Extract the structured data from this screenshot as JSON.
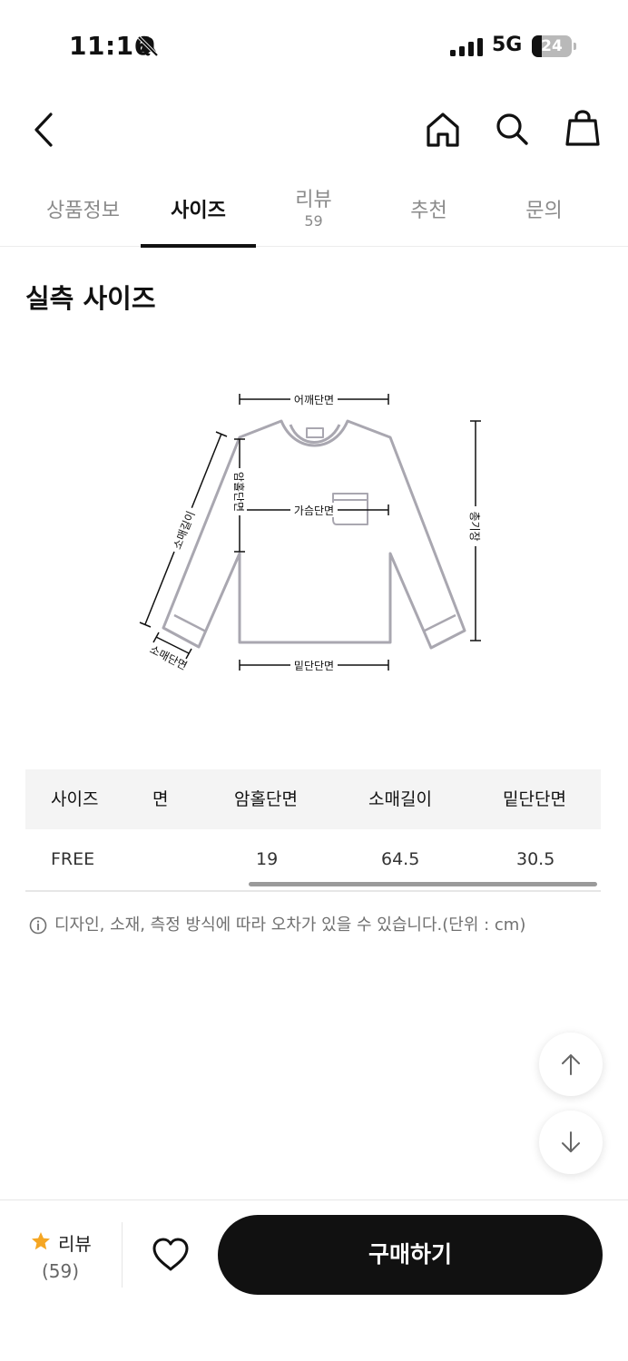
{
  "status_bar": {
    "time": "11:16",
    "network": "5G",
    "battery_level": 24,
    "battery_text": "24",
    "icons": [
      "bell-slash-icon",
      "signal-icon",
      "battery-icon"
    ]
  },
  "header": {
    "icons": [
      "back-arrow-icon",
      "home-icon",
      "search-icon",
      "shopping-bag-icon"
    ]
  },
  "tabs": [
    {
      "label": "상품정보",
      "active": false
    },
    {
      "label": "사이즈",
      "active": true
    },
    {
      "label": "리뷰",
      "count": "59",
      "active": false
    },
    {
      "label": "추천",
      "active": false
    },
    {
      "label": "문의",
      "active": false
    }
  ],
  "section_title": "실측 사이즈",
  "diagram": {
    "labels": {
      "shoulder": "어깨단면",
      "chest": "가슴단면",
      "armhole": "암홀단면",
      "sleeve_length": "소매길이",
      "sleeve_width": "소매단면",
      "hem": "밑단단면",
      "total_length": "총기장"
    }
  },
  "size_table": {
    "headers": [
      "사이즈",
      "면",
      "암홀단면",
      "소매길이",
      "밑단단면"
    ],
    "rows": [
      [
        "FREE",
        "",
        "19",
        "64.5",
        "30.5"
      ]
    ]
  },
  "notice": {
    "icon": "info-circle-icon",
    "text": "디자인, 소재, 측정 방식에 따라 오차가 있을 수 있습니다.(단위 : cm)"
  },
  "floating": {
    "up_icon": "arrow-up-icon",
    "down_icon": "arrow-down-icon"
  },
  "bottom_bar": {
    "review_label": "리뷰",
    "review_count": "(59)",
    "buy_label": "구매하기",
    "colors": {
      "star": "#f5a623",
      "button": "#111111"
    }
  }
}
